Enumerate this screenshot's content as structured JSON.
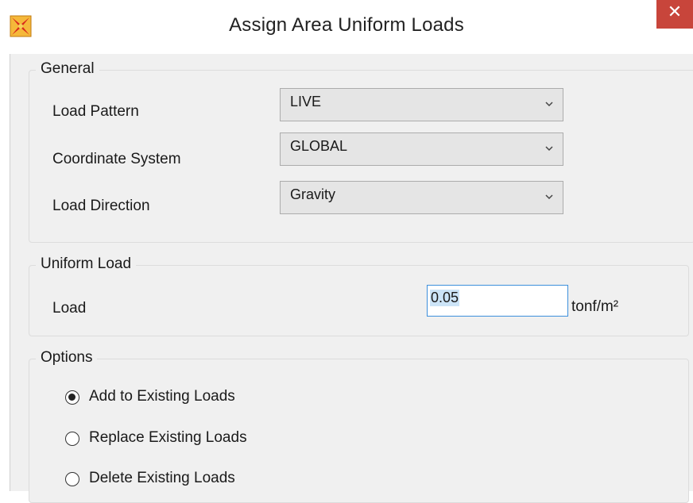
{
  "window": {
    "title": "Assign Area Uniform Loads",
    "close_label": "✕",
    "accent_color": "#c8453b"
  },
  "general": {
    "legend": "General",
    "load_pattern": {
      "label": "Load Pattern",
      "value": "LIVE"
    },
    "coordinate_system": {
      "label": "Coordinate System",
      "value": "GLOBAL"
    },
    "load_direction": {
      "label": "Load Direction",
      "value": "Gravity"
    }
  },
  "uniform_load": {
    "legend": "Uniform Load",
    "load_label": "Load",
    "load_value": "0.05",
    "units": "tonf/m²"
  },
  "options": {
    "legend": "Options",
    "add": {
      "label": "Add to Existing Loads",
      "selected": true
    },
    "replace": {
      "label": "Replace Existing Loads",
      "selected": false
    },
    "delete": {
      "label": "Delete Existing Loads",
      "selected": false
    }
  },
  "icons": {
    "app": "sap-app-icon",
    "combo_arrow": "chevron-down-icon"
  }
}
